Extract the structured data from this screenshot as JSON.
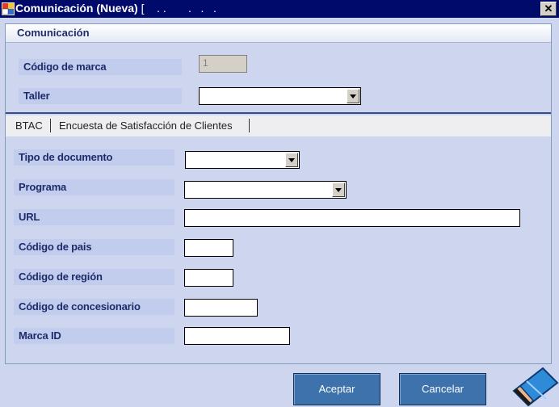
{
  "window": {
    "title": "Comunicación (Nueva)",
    "title_tail": " [    . .       .   .   . ",
    "close_glyph": "✕"
  },
  "panel": {
    "header": "Comunicación",
    "codigo_marca": {
      "label": "Código de marca",
      "value": "1"
    },
    "taller": {
      "label": "Taller",
      "value": ""
    }
  },
  "tabs": [
    {
      "label": "BTAC"
    },
    {
      "label": "Encuesta de Satisfacción de Clientes"
    }
  ],
  "form": {
    "tipo_documento": {
      "label": "Tipo de documento",
      "value": ""
    },
    "programa": {
      "label": "Programa",
      "value": ""
    },
    "url": {
      "label": "URL",
      "value": ""
    },
    "codigo_pais": {
      "label": "Código de pais",
      "value": ""
    },
    "codigo_region": {
      "label": "Código de región",
      "value": ""
    },
    "codigo_concesionario": {
      "label": "Código de concesionario",
      "value": ""
    },
    "marca_id": {
      "label": "Marca ID",
      "value": ""
    }
  },
  "buttons": {
    "aceptar": "Aceptar",
    "cancelar": "Cancelar"
  },
  "colors": {
    "titlebar": "#000a6a",
    "background": "#ced5ef",
    "label_bg": "#c2ccec",
    "button": "#3d72ac"
  }
}
